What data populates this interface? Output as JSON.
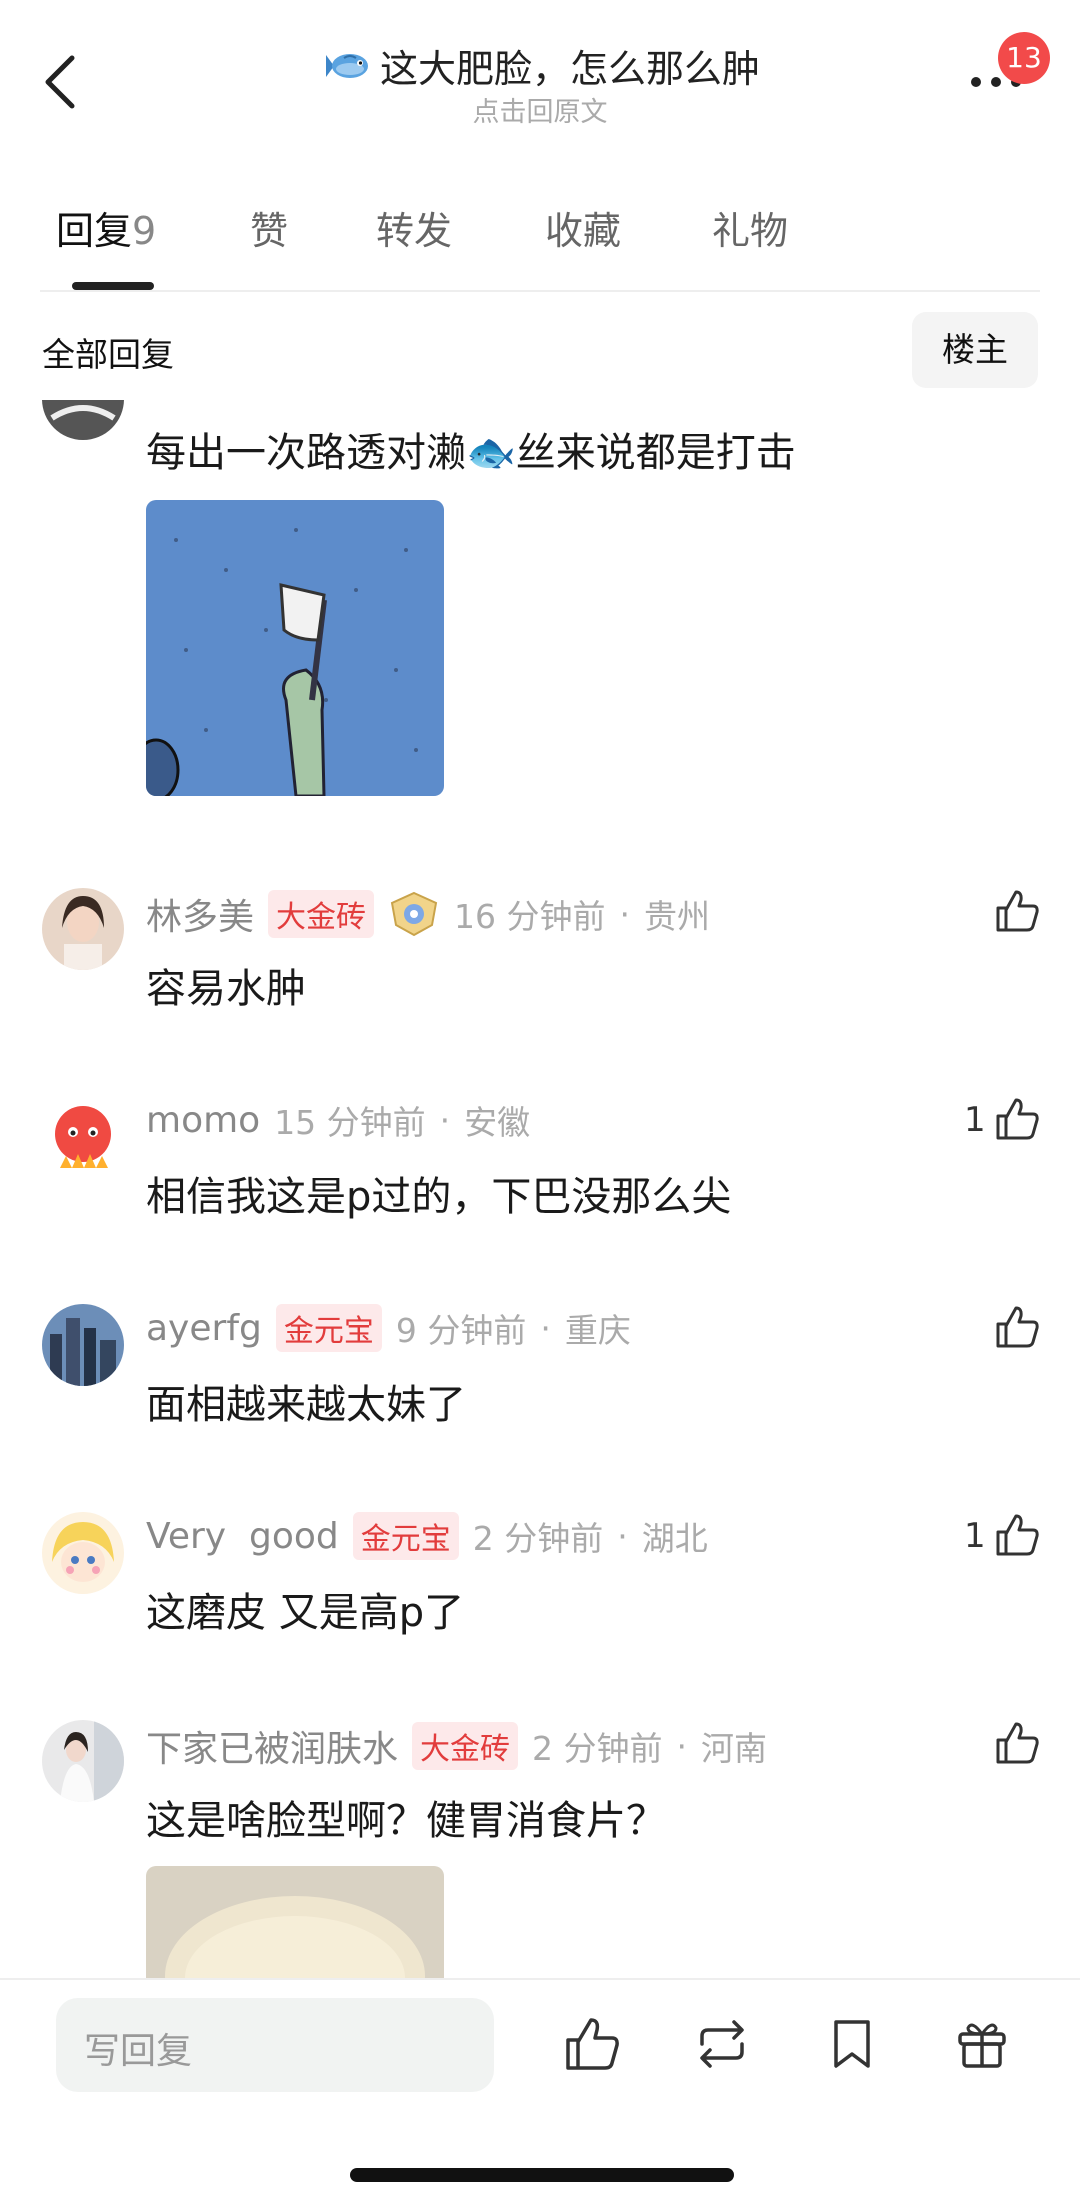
{
  "header": {
    "title": "这大肥脸，怎么那么肿",
    "subtitle": "点击回原文",
    "notification_count": "13"
  },
  "tabs": [
    {
      "label": "回复",
      "count": "9"
    },
    {
      "label": "赞"
    },
    {
      "label": "转发"
    },
    {
      "label": "收藏"
    },
    {
      "label": "礼物"
    }
  ],
  "filter": {
    "all_label": "全部回复",
    "op_label": "楼主"
  },
  "comments": [
    {
      "name": "",
      "tag": "",
      "time": "",
      "location": "",
      "text": "每出一次路透对濑🐟丝来说都是打击",
      "likes": ""
    },
    {
      "name": "林多美",
      "tag": "大金砖",
      "time": "16 分钟前",
      "location": "贵州",
      "text": "容易水肿",
      "likes": ""
    },
    {
      "name": "momo",
      "tag": "",
      "time": "15 分钟前",
      "location": "安徽",
      "text": "相信我这是p过的，下巴没那么尖",
      "likes": "1"
    },
    {
      "name": "ayerfg",
      "tag": "金元宝",
      "time": "9 分钟前",
      "location": "重庆",
      "text": "面相越来越太妹了",
      "likes": ""
    },
    {
      "name": "Very  good",
      "tag": "金元宝",
      "time": "2 分钟前",
      "location": "湖北",
      "text": "这磨皮 又是高p了",
      "likes": "1"
    },
    {
      "name": "下家已被润肤水",
      "tag": "大金砖",
      "time": "2 分钟前",
      "location": "河南",
      "text": "这是啥脸型啊？健胃消食片？",
      "likes": ""
    }
  ],
  "bottom_bar": {
    "reply_placeholder": "写回复"
  },
  "colors": {
    "accent_red": "#e23c3c",
    "badge_red": "#f24a4a",
    "tag_bg": "#fde9ea"
  },
  "icons": [
    "back-icon",
    "fish-emoji-icon",
    "more-icon",
    "like-icon",
    "repost-icon",
    "bookmark-icon",
    "gift-icon"
  ]
}
